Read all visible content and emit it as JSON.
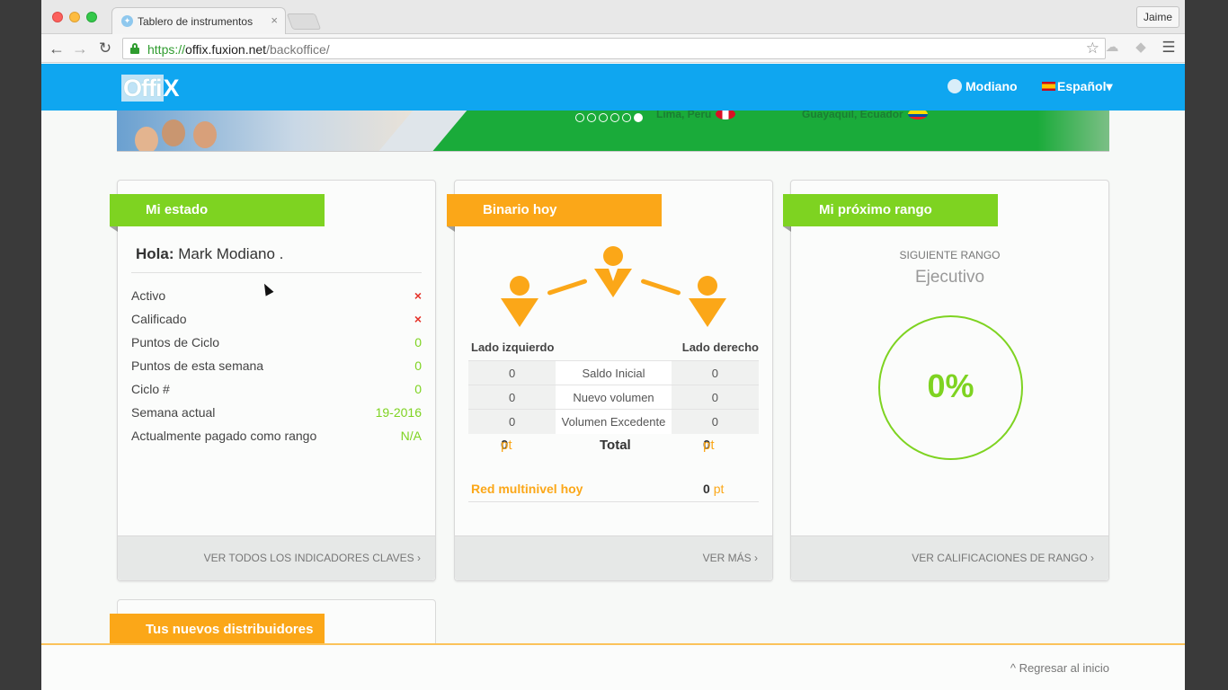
{
  "browser": {
    "tab_title": "Tablero de instrumentos",
    "tab_close": "×",
    "profile_name": "Jaime",
    "url_scheme": "https://",
    "url_host": "offix.fuxion.net",
    "url_path": "/backoffice/",
    "icons": [
      "back-icon",
      "forward-icon",
      "reload-icon",
      "star-icon",
      "menu-icon"
    ]
  },
  "header": {
    "logo_offi": "Offi",
    "logo_x": "X",
    "user_name": "Modiano",
    "language": "Español",
    "language_caret": "▾"
  },
  "banner": {
    "city1": "Lima, Peru",
    "city2": "Guayaquil, Ecuador",
    "slide_count": 6,
    "active_slide": 6
  },
  "card_status": {
    "title": "Mi estado",
    "greeting_label": "Hola:",
    "greeting_name": "Mark Modiano .",
    "stats": [
      {
        "label": "Activo",
        "value": "×",
        "type": "x"
      },
      {
        "label": "Calificado",
        "value": "×",
        "type": "x"
      },
      {
        "label": "Puntos de Ciclo",
        "value": "0",
        "type": "val"
      },
      {
        "label": "Puntos de esta semana",
        "value": "0",
        "type": "val"
      },
      {
        "label": "Ciclo #",
        "value": "0",
        "type": "val"
      },
      {
        "label": "Semana actual",
        "value": "19-2016",
        "type": "val"
      },
      {
        "label": "Actualmente pagado como rango",
        "value": "N/A",
        "type": "val"
      }
    ],
    "footer_link": "VER TODOS LOS INDICADORES CLAVES ›"
  },
  "card_binary": {
    "title": "Binario hoy",
    "left_label": "Lado izquierdo",
    "right_label": "Lado derecho",
    "rows": [
      {
        "left": "0",
        "label": "Saldo Inicial",
        "right": "0"
      },
      {
        "left": "0",
        "label": "Nuevo volumen",
        "right": "0"
      },
      {
        "left": "0",
        "label": "Volumen Excedente",
        "right": "0"
      }
    ],
    "total_label": "Total",
    "total_left": "0",
    "total_right": "0",
    "pt_unit": "pt",
    "network_label": "Red multinivel hoy",
    "network_value": "0",
    "footer_link": "VER MÁS ›"
  },
  "card_rank": {
    "title": "Mi próximo rango",
    "next_label": "SIGUIENTE RANGO",
    "next_rank": "Ejecutivo",
    "progress_text": "0%",
    "progress_fraction": 0,
    "footer_link": "VER CALIFICACIONES DE RANGO ›"
  },
  "card_distributors": {
    "title": "Tus nuevos distribuidores"
  },
  "footer": {
    "back_to_top": "Regresar al inicio",
    "back_icon": "^"
  },
  "colors": {
    "header_blue": "#0fa6f0",
    "accent_green": "#7ed321",
    "accent_orange": "#fba718",
    "error_red": "#e5332a"
  }
}
